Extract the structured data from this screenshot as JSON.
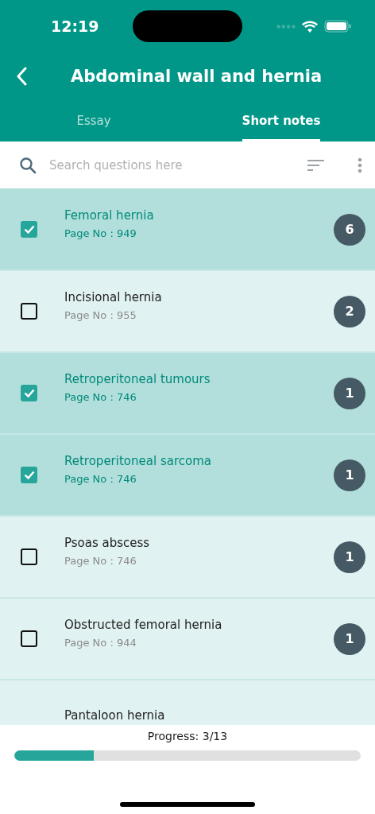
{
  "status_bar": {
    "time": "12:19"
  },
  "header": {
    "title": "Abdominal wall and hernia"
  },
  "tabs": [
    {
      "label": "Essay",
      "selected": false
    },
    {
      "label": "Short notes",
      "selected": true
    }
  ],
  "search": {
    "placeholder": "Search questions here"
  },
  "questions": [
    {
      "title": "Femoral hernia",
      "page": "Page No : 949",
      "count": "6",
      "checked": true
    },
    {
      "title": "Incisional hernia",
      "page": "Page No : 955",
      "count": "2",
      "checked": false
    },
    {
      "title": "Retroperitoneal tumours",
      "page": "Page No : 746",
      "count": "1",
      "checked": true
    },
    {
      "title": "Retroperitoneal sarcoma",
      "page": "Page No : 746",
      "count": "1",
      "checked": true
    },
    {
      "title": "Psoas abscess",
      "page": "Page No : 746",
      "count": "1",
      "checked": false
    },
    {
      "title": "Obstructed femoral hernia",
      "page": "Page No : 944",
      "count": "1",
      "checked": false
    },
    {
      "title": "Pantaloon hernia"
    }
  ],
  "progress": {
    "label": "Progress: 3/13",
    "level": 0.23
  }
}
